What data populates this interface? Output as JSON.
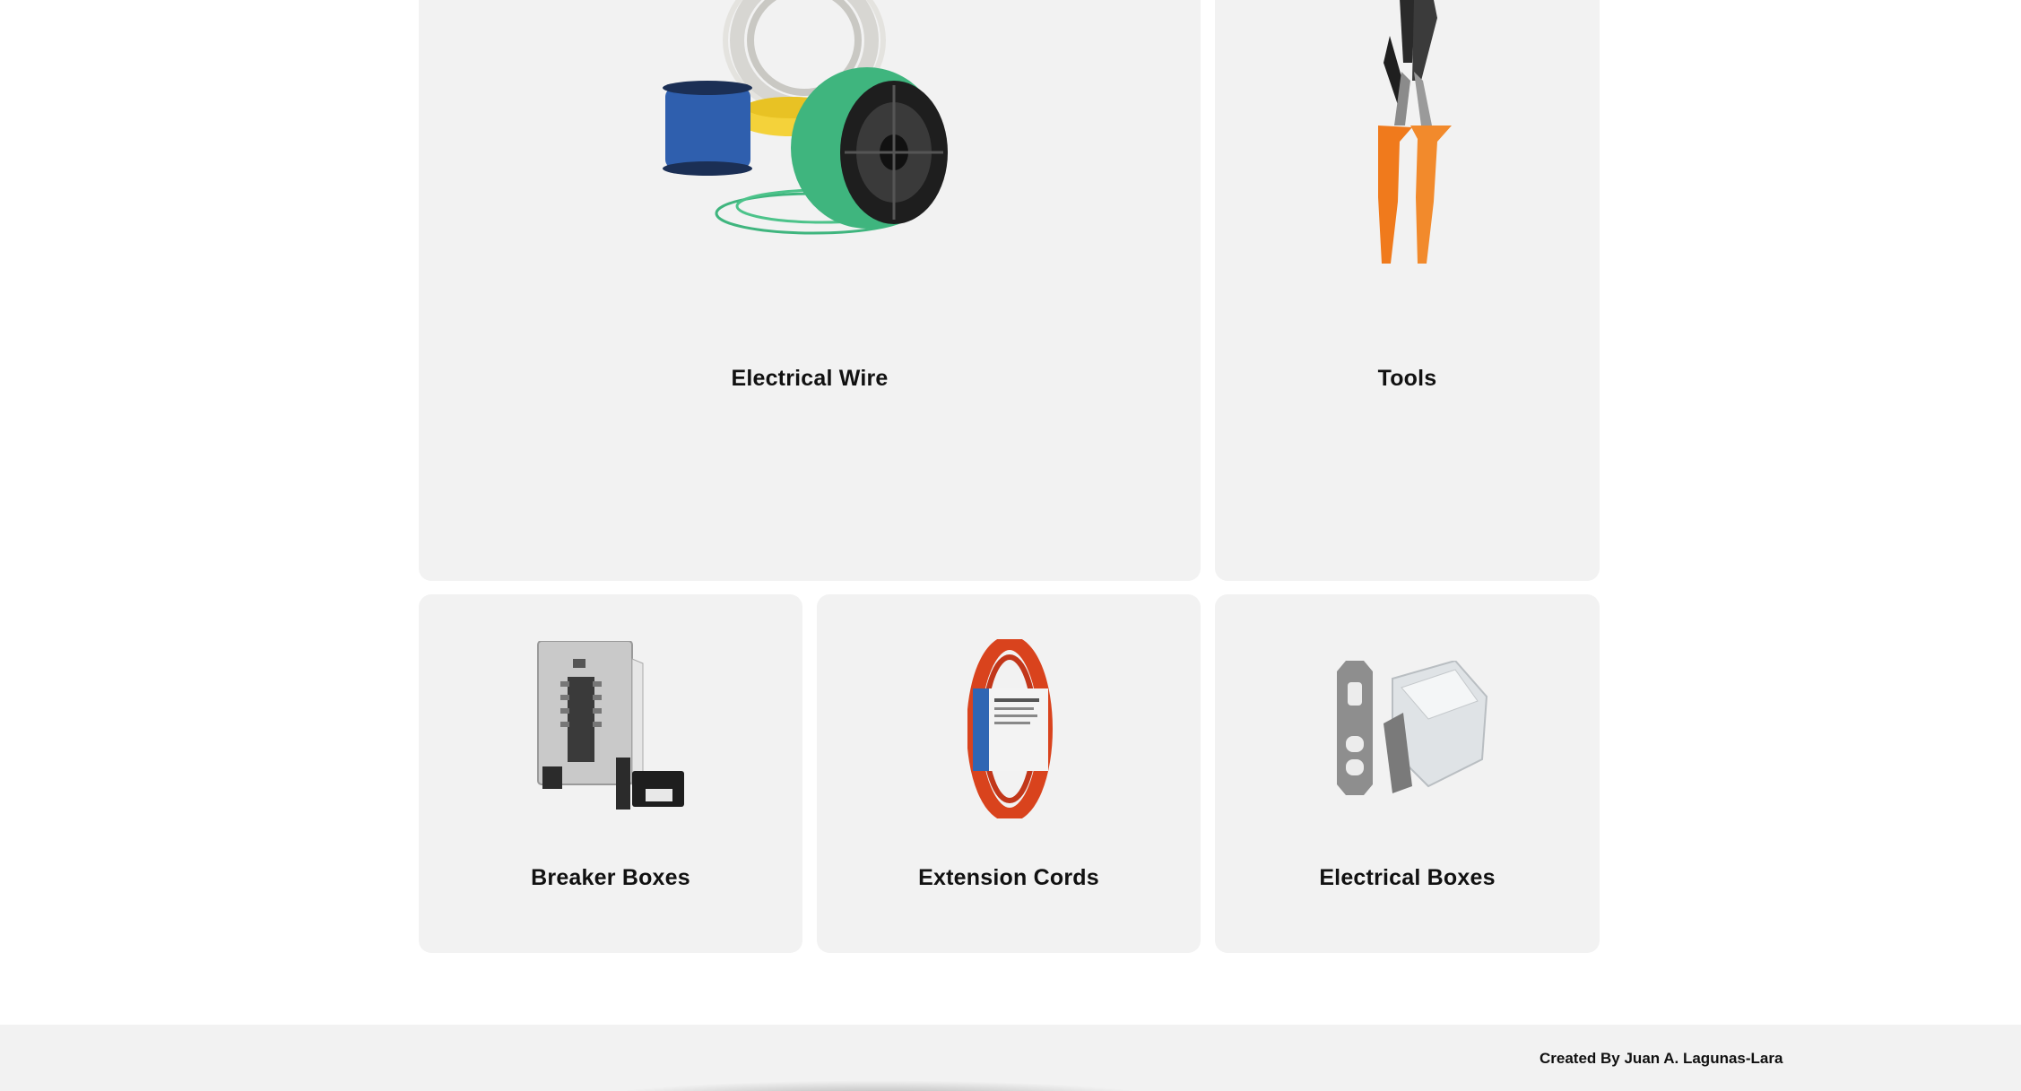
{
  "categories": {
    "electrical_wire": {
      "label": "Electrical Wire",
      "icon": "wire-spools-icon"
    },
    "tools": {
      "label": "Tools",
      "icon": "pliers-icon"
    },
    "breaker_boxes": {
      "label": "Breaker Boxes",
      "icon": "breaker-panel-icon"
    },
    "extension_cords": {
      "label": "Extension Cords",
      "icon": "extension-cord-icon"
    },
    "electrical_boxes": {
      "label": "Electrical Boxes",
      "icon": "electrical-box-icon"
    }
  },
  "footer": {
    "credit": "Created By Juan A. Lagunas-Lara"
  },
  "colors": {
    "card_bg": "#f2f2f2",
    "footer_bg": "#f2f2f2",
    "wire_blue": "#2f5fae",
    "wire_green": "#3fb57e",
    "wire_yellow": "#f4d23a",
    "pliers_orange": "#f07a1c",
    "cord_orange": "#d9431d"
  }
}
